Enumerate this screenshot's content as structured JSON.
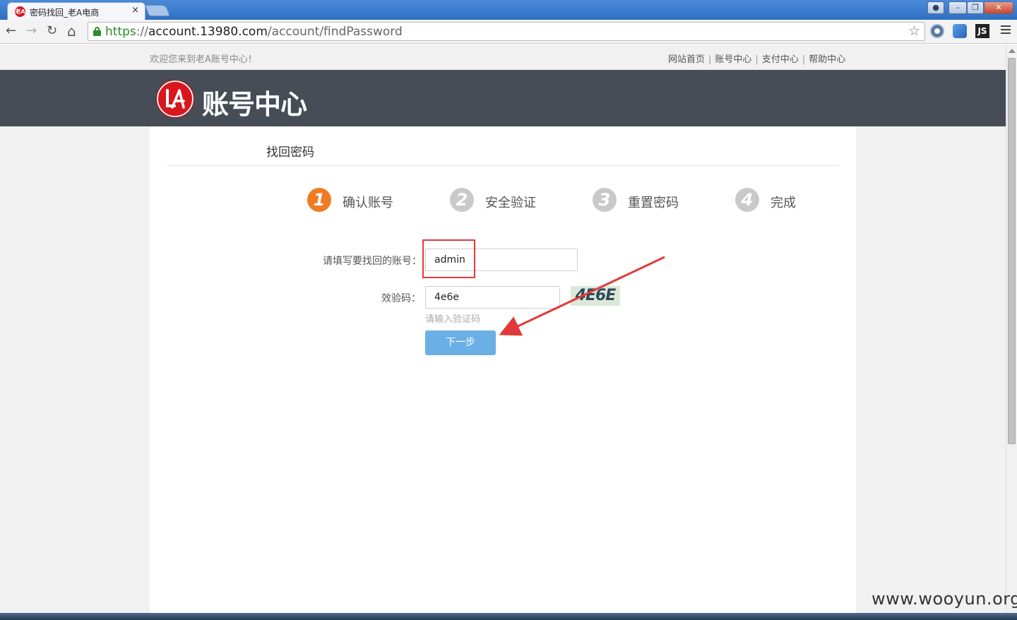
{
  "browser": {
    "tab_title": "密码找回_老A电商",
    "tab_favicon": "老A",
    "tab_close": "×",
    "url_scheme": "https",
    "url_sep": "://",
    "url_host": "account.13980.com",
    "url_path": "/account/findPassword",
    "nav_back": "←",
    "nav_forward": "→",
    "nav_reload": "↻",
    "nav_home": "⌂",
    "star": "☆",
    "ext_js": "JS"
  },
  "page": {
    "welcome": "欢迎您来到老A账号中心！",
    "top_links": [
      "网站首页",
      "账号中心",
      "支付中心",
      "帮助中心"
    ],
    "logo_text": "账号中心",
    "section_title": "找回密码",
    "steps": [
      {
        "num": "1",
        "label": "确认账号",
        "state": "active"
      },
      {
        "num": "2",
        "label": "安全验证",
        "state": "inactive"
      },
      {
        "num": "3",
        "label": "重置密码",
        "state": "inactive"
      },
      {
        "num": "4",
        "label": "完成",
        "state": "inactive"
      }
    ],
    "account_label": "请填写要找回的账号：",
    "account_value": "admin",
    "captcha_label": "效验码：",
    "captcha_value": "4e6e",
    "captcha_image_text": "4E6E",
    "captcha_hint": "请输入验证码",
    "next_button": "下一步"
  },
  "colors": {
    "header_bg": "#464d57",
    "step_active": "#ef7b23",
    "step_inactive": "#c9c9c9",
    "button_bg": "#6ab0e6",
    "annotation_red": "#e23a3a",
    "logo_red": "#d8161e"
  },
  "watermark": "www.wooyun.org"
}
